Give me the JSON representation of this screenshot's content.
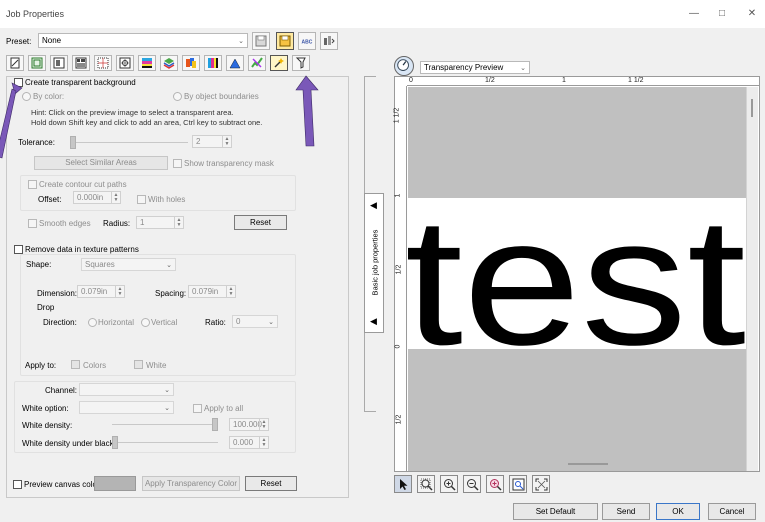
{
  "window": {
    "title": "Job Properties",
    "controls": [
      "minimize-icon",
      "maximize-icon",
      "close-icon"
    ]
  },
  "preset": {
    "label": "Preset:",
    "value": "None"
  },
  "toolbar_icons": [
    "save-preset-icon",
    "save-as-preset-icon",
    "abc-icon",
    "preset-manager-icon"
  ],
  "tabs": [
    "job-info-tab",
    "size-tab",
    "layout-tab",
    "nest-tab",
    "tile-tab",
    "marks-tab",
    "color-tab",
    "color-management-tab",
    "spot-color-tab",
    "channels-tab",
    "sharpen-tab",
    "finishing-tab",
    "transparency-tab",
    "output-tab"
  ],
  "transparency": {
    "create_bg_label": "Create transparent background",
    "by_color_label": "By color:",
    "by_object_label": "By object boundaries",
    "hint_line1": "Hint: Click on the preview image to select a transparent area.",
    "hint_line2": "Hold down Shift key and click to add an area, Ctrl key to subtract one.",
    "tolerance_label": "Tolerance:",
    "tolerance_value": "2",
    "select_similar_label": "Select Similar Areas",
    "show_mask_label": "Show transparency mask",
    "contour_label": "Create contour cut paths",
    "offset_label": "Offset:",
    "offset_value": "0.000in",
    "with_holes_label": "With holes",
    "smooth_label": "Smooth edges",
    "radius_label": "Radius:",
    "radius_value": "1",
    "reset_label": "Reset"
  },
  "texture": {
    "remove_label": "Remove data in texture patterns",
    "shape_label": "Shape:",
    "shape_value": "Squares",
    "dimension_label": "Dimension:",
    "dimension_value": "0.079in",
    "spacing_label": "Spacing:",
    "spacing_value": "0.079in",
    "drop_label": "Drop",
    "direction_label": "Direction:",
    "horizontal_label": "Horizontal",
    "vertical_label": "Vertical",
    "ratio_label": "Ratio:",
    "ratio_value": "0",
    "apply_to_label": "Apply to:",
    "colors_label": "Colors",
    "white_label": "White"
  },
  "white": {
    "channel_label": "Channel:",
    "white_option_label": "White option:",
    "apply_all_label": "Apply to all",
    "white_density_label": "White density:",
    "white_density_value": "100.000",
    "under_black_label": "White density under black:",
    "under_black_value": "0.000"
  },
  "canvas": {
    "preview_label": "Preview canvas color",
    "apply_transparency_label": "Apply Transparency Color",
    "reset_label": "Reset",
    "swatch_color": "#b4b4b4"
  },
  "collapse": {
    "label": "Basic job properties"
  },
  "preview": {
    "mode": "Transparency Preview",
    "ruler_top": [
      "0",
      "1/2",
      "1",
      "1 1/2"
    ],
    "ruler_left": [
      "1 1/2",
      "1",
      "1/2",
      "0",
      "1/2"
    ],
    "image_text": "test",
    "tools": [
      "pointer-icon",
      "zoom-select-icon",
      "zoom-in-icon",
      "zoom-out-icon",
      "zoom-selection-icon",
      "zoom-actual-icon",
      "fit-screen-icon"
    ]
  },
  "footer": {
    "set_default": "Set Default",
    "send": "Send",
    "ok": "OK",
    "cancel": "Cancel"
  },
  "colors": {
    "annotation_arrow": "#7a58b8",
    "preview_bg": "#c0c0c0"
  }
}
